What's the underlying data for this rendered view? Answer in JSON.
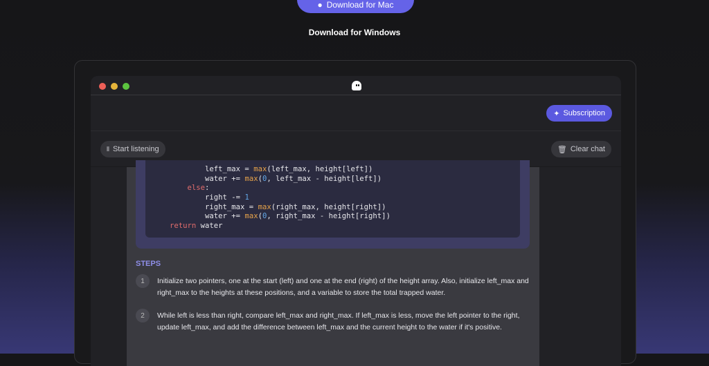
{
  "hero": {
    "mac_label": "Download for Mac",
    "windows_label": "Download for Windows"
  },
  "toolbar": {
    "subscription_label": "Subscription",
    "start_listening_label": "Start listening",
    "clear_chat_label": "Clear chat"
  },
  "code_lines": [
    [
      {
        "t": "        left_max = "
      },
      {
        "t": "max",
        "c": "fn"
      },
      {
        "t": "(left_max, height[left])"
      }
    ],
    [
      {
        "t": "        water += "
      },
      {
        "t": "max",
        "c": "fn"
      },
      {
        "t": "("
      },
      {
        "t": "0",
        "c": "num"
      },
      {
        "t": ", left_max - height[left])"
      }
    ],
    [
      {
        "t": "    "
      },
      {
        "t": "else",
        "c": "kw"
      },
      {
        "t": ":"
      }
    ],
    [
      {
        "t": "        right -= "
      },
      {
        "t": "1",
        "c": "num"
      }
    ],
    [
      {
        "t": "        right_max = "
      },
      {
        "t": "max",
        "c": "fn"
      },
      {
        "t": "(right_max, height[right])"
      }
    ],
    [
      {
        "t": "        water += "
      },
      {
        "t": "max",
        "c": "fn"
      },
      {
        "t": "("
      },
      {
        "t": "0",
        "c": "num"
      },
      {
        "t": ", right_max - height[right])"
      }
    ],
    [
      {
        "t": "return",
        "c": "kw"
      },
      {
        "t": " water"
      }
    ]
  ],
  "steps": {
    "heading": "STEPS",
    "items": [
      {
        "num": "1",
        "text": "Initialize two pointers, one at the start (left) and one at the end (right) of the height array. Also, initialize left_max and right_max to the heights at these positions, and a variable to store the total trapped water."
      },
      {
        "num": "2",
        "text": "While left is less than right, compare left_max and right_max. If left_max is less, move the left pointer to the right, update left_max, and add the difference between left_max and the current height to the water if it's positive."
      }
    ]
  },
  "colors": {
    "accent": "#5b59e0",
    "close": "#ec5f57",
    "minimize": "#e5b43a",
    "maximize": "#5cc43f"
  }
}
